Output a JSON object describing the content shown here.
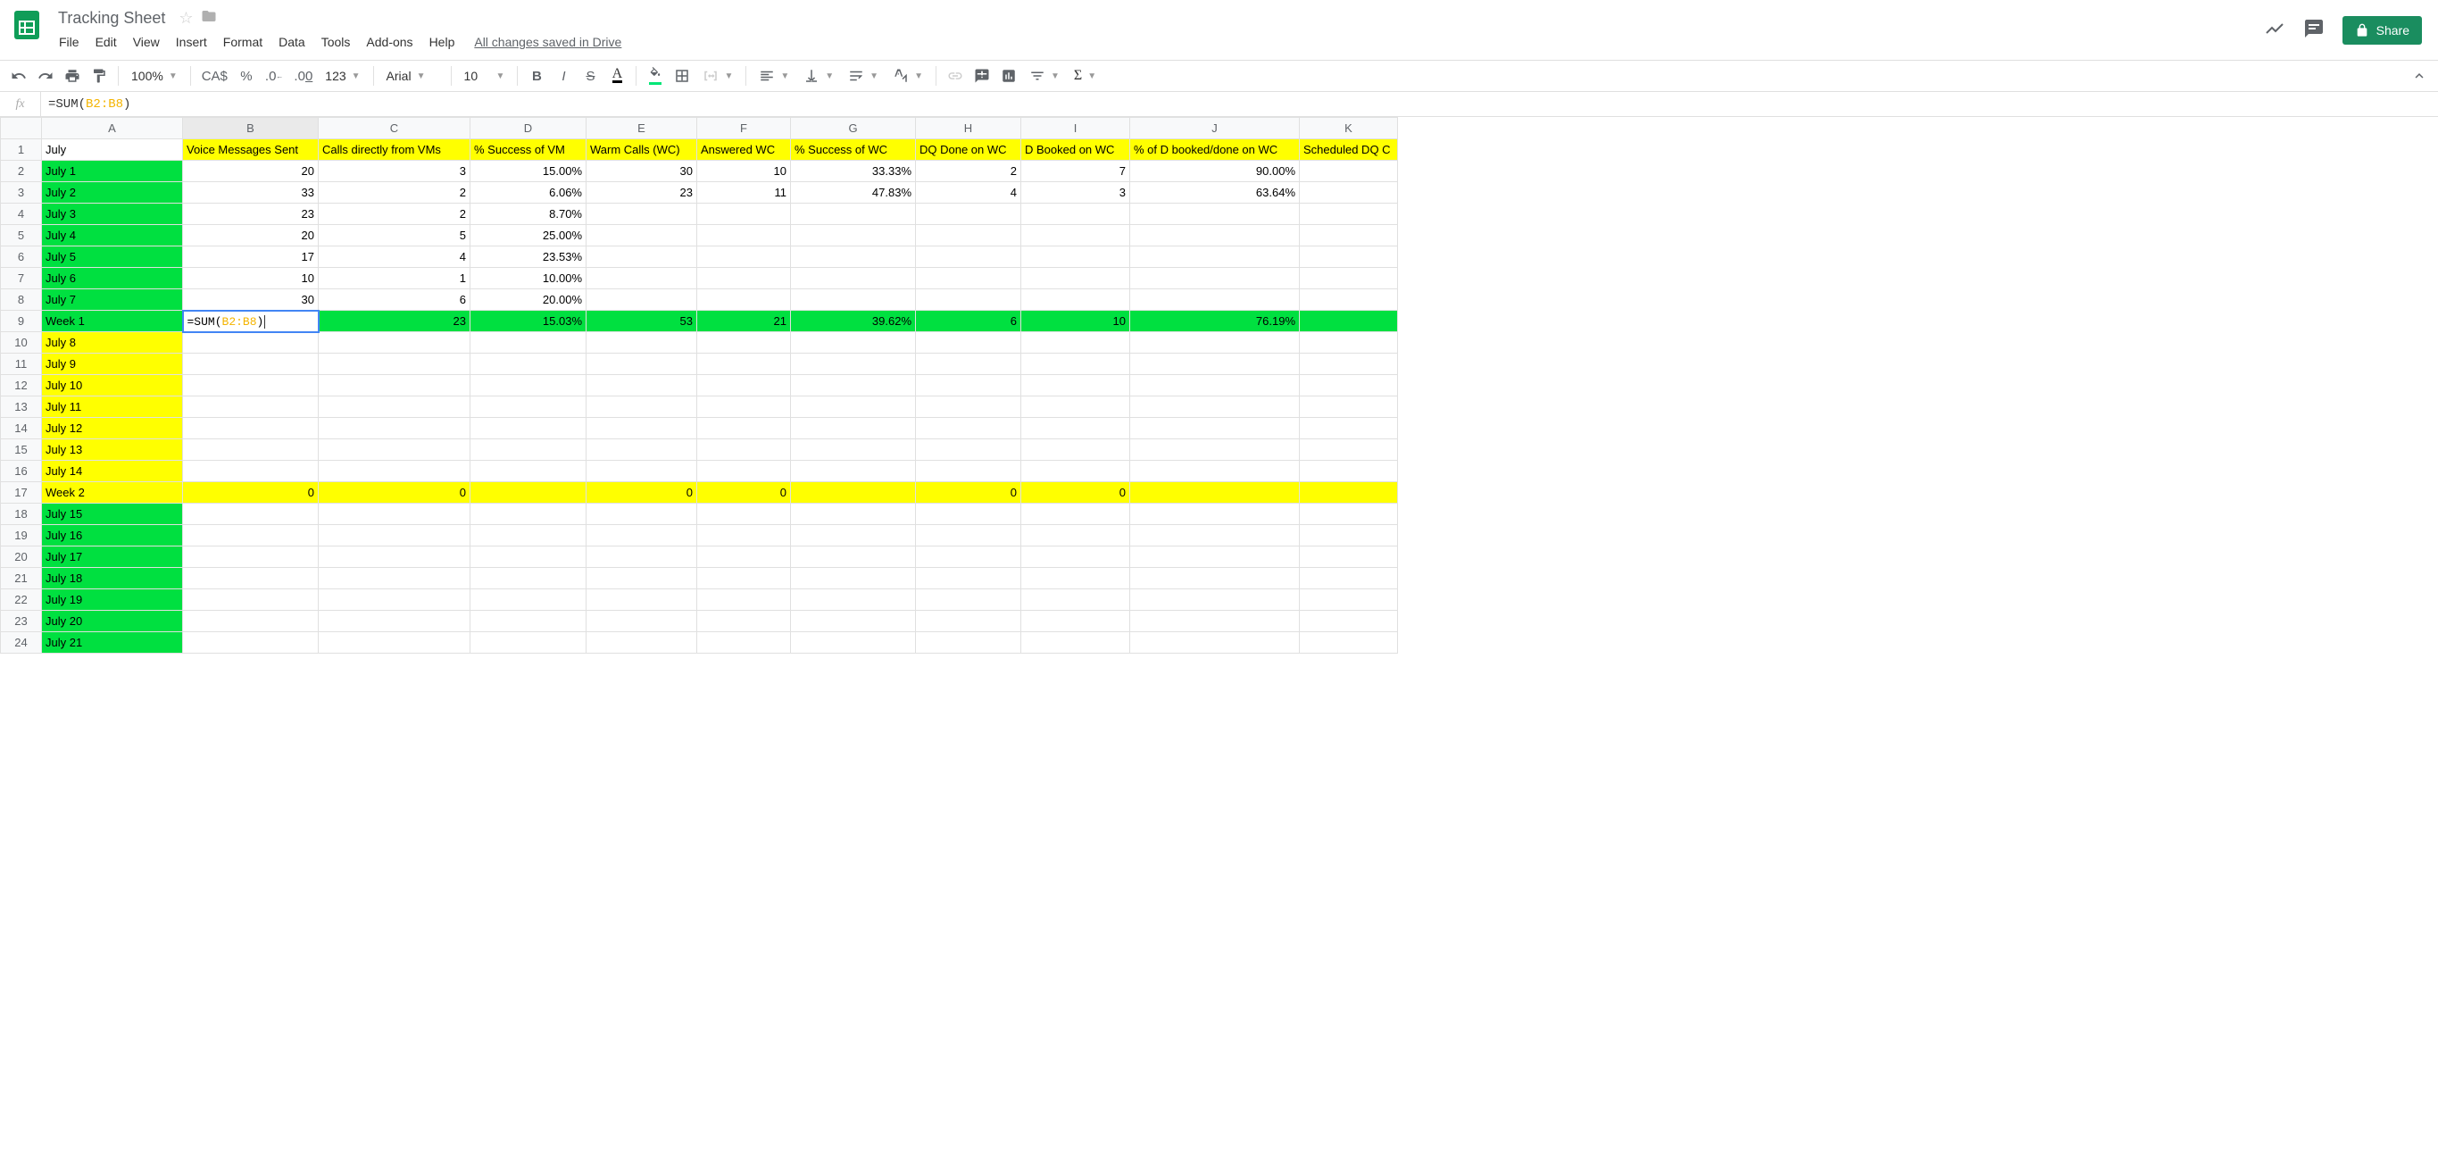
{
  "doc": {
    "title": "Tracking Sheet",
    "save_status": "All changes saved in Drive"
  },
  "menu": {
    "file": "File",
    "edit": "Edit",
    "view": "View",
    "insert": "Insert",
    "format": "Format",
    "data": "Data",
    "tools": "Tools",
    "addons": "Add-ons",
    "help": "Help"
  },
  "share": {
    "label": "Share"
  },
  "toolbar": {
    "zoom": "100%",
    "currency": "CA$",
    "percent": "%",
    "dec_less": ".0",
    "dec_more": ".00",
    "num_fmt": "123",
    "font": "Arial",
    "size": "10"
  },
  "formula": {
    "raw": "=SUM(B2:B8)",
    "prefix": "=SUM(",
    "range": "B2:B8",
    "suffix": ")"
  },
  "columns": [
    "A",
    "B",
    "C",
    "D",
    "E",
    "F",
    "G",
    "H",
    "I",
    "J",
    "K"
  ],
  "headers": {
    "A": "July",
    "B": "Voice Messages Sent",
    "C": "Calls directly from VMs",
    "D": "% Success of VM",
    "E": "Warm Calls (WC)",
    "F": "Answered WC",
    "G": "% Success of WC",
    "H": "DQ Done on WC",
    "I": "D Booked on WC",
    "J": "% of D booked/done on WC",
    "K": "Scheduled DQ C"
  },
  "rows": [
    {
      "n": 1,
      "label": "July 1",
      "bg": "green",
      "B": "20",
      "C": "3",
      "D": "15.00%",
      "E": "30",
      "F": "10",
      "G": "33.33%",
      "H": "2",
      "I": "7",
      "J": "90.00%"
    },
    {
      "n": 2,
      "label": "July 2",
      "bg": "green",
      "B": "33",
      "C": "2",
      "D": "6.06%",
      "E": "23",
      "F": "11",
      "G": "47.83%",
      "H": "4",
      "I": "3",
      "J": "63.64%"
    },
    {
      "n": 3,
      "label": "July 3",
      "bg": "green",
      "B": "23",
      "C": "2",
      "D": "8.70%"
    },
    {
      "n": 4,
      "label": "July 4",
      "bg": "green",
      "B": "20",
      "C": "5",
      "D": "25.00%"
    },
    {
      "n": 5,
      "label": "July 5",
      "bg": "green",
      "B": "17",
      "C": "4",
      "D": "23.53%"
    },
    {
      "n": 6,
      "label": "July 6",
      "bg": "green",
      "B": "10",
      "C": "1",
      "D": "10.00%"
    },
    {
      "n": 7,
      "label": "July 7",
      "bg": "green",
      "B": "30",
      "C": "6",
      "D": "20.00%"
    },
    {
      "n": 8,
      "label": "Week 1",
      "bg": "green",
      "row_bg": "green",
      "editing": true,
      "B_edit": "=SUM(B2:B8)",
      "C": "23",
      "D": "15.03%",
      "E": "53",
      "F": "21",
      "G": "39.62%",
      "H": "6",
      "I": "10",
      "J": "76.19%"
    },
    {
      "n": 9,
      "label": "July 8",
      "bg": "yellow"
    },
    {
      "n": 10,
      "label": "July 9",
      "bg": "yellow"
    },
    {
      "n": 11,
      "label": "July 10",
      "bg": "yellow"
    },
    {
      "n": 12,
      "label": "July 11",
      "bg": "yellow"
    },
    {
      "n": 13,
      "label": "July 12",
      "bg": "yellow"
    },
    {
      "n": 14,
      "label": "July 13",
      "bg": "yellow"
    },
    {
      "n": 15,
      "label": "July 14",
      "bg": "yellow"
    },
    {
      "n": 16,
      "label": "Week 2",
      "bg": "yellow",
      "row_bg": "yellow",
      "B": "0",
      "C": "0",
      "E": "0",
      "F": "0",
      "H": "0",
      "I": "0"
    },
    {
      "n": 17,
      "label": "July 15",
      "bg": "green"
    },
    {
      "n": 18,
      "label": "July 16",
      "bg": "green"
    },
    {
      "n": 19,
      "label": "July 17",
      "bg": "green"
    },
    {
      "n": 20,
      "label": "July 18",
      "bg": "green"
    },
    {
      "n": 21,
      "label": "July 19",
      "bg": "green"
    },
    {
      "n": 22,
      "label": "July 20",
      "bg": "green"
    },
    {
      "n": 23,
      "label": "July 21",
      "bg": "green"
    }
  ]
}
